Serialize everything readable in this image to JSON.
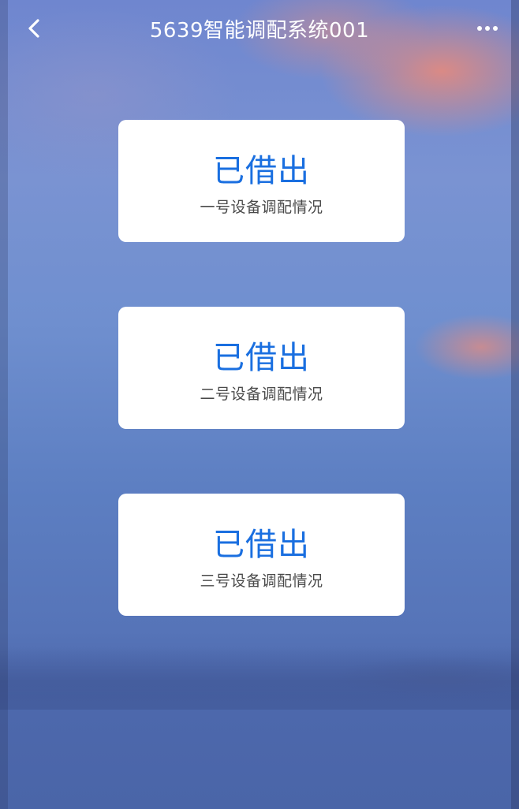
{
  "header": {
    "title": "5639智能调配系统001",
    "back_icon": "chevron-left-icon",
    "more_icon": "more-horizontal-icon"
  },
  "cards": [
    {
      "status": "已借出",
      "description": "一号设备调配情况"
    },
    {
      "status": "已借出",
      "description": "二号设备调配情况"
    },
    {
      "status": "已借出",
      "description": "三号设备调配情况"
    }
  ],
  "colors": {
    "accent": "#1a6fe0",
    "card_bg": "#ffffff",
    "header_text": "#ffffff",
    "desc_text": "#4a4a4a"
  }
}
